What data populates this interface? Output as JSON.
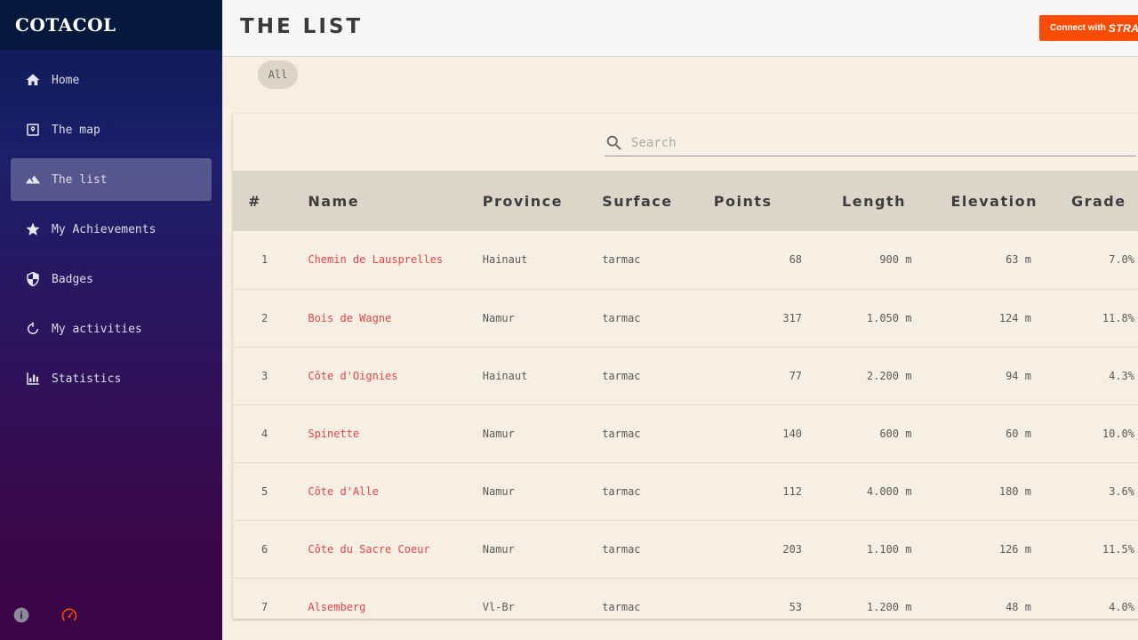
{
  "app": {
    "logo": "COTACOL"
  },
  "sidebar": {
    "items": [
      {
        "label": "Home",
        "icon": "home-icon"
      },
      {
        "label": "The map",
        "icon": "map-icon"
      },
      {
        "label": "The list",
        "icon": "mountain-icon",
        "active": true
      },
      {
        "label": "My Achievements",
        "icon": "star-icon"
      },
      {
        "label": "Badges",
        "icon": "shield-icon"
      },
      {
        "label": "My activities",
        "icon": "timer-icon"
      },
      {
        "label": "Statistics",
        "icon": "bar-chart-icon"
      }
    ],
    "bottom_icons": [
      "info-icon",
      "gauge-icon"
    ]
  },
  "header": {
    "title": "THE LIST",
    "strava_prefix": "Connect with",
    "strava_brand": "STRAVA"
  },
  "filters": {
    "chip": "All"
  },
  "search": {
    "placeholder": "Search"
  },
  "table": {
    "columns": [
      "#",
      "Name",
      "Province",
      "Surface",
      "Points",
      "Length",
      "Elevation",
      "Grade"
    ],
    "rows": [
      {
        "n": "1",
        "name": "Chemin de Lausprelles",
        "province": "Hainaut",
        "surface": "tarmac",
        "points": "68",
        "length": "900 m",
        "elevation": "63 m",
        "grade": "7.0%"
      },
      {
        "n": "2",
        "name": "Bois de Wagne",
        "province": "Namur",
        "surface": "tarmac",
        "points": "317",
        "length": "1.050 m",
        "elevation": "124 m",
        "grade": "11.8%"
      },
      {
        "n": "3",
        "name": "Côte d'Oignies",
        "province": "Hainaut",
        "surface": "tarmac",
        "points": "77",
        "length": "2.200 m",
        "elevation": "94 m",
        "grade": "4.3%"
      },
      {
        "n": "4",
        "name": "Spinette",
        "province": "Namur",
        "surface": "tarmac",
        "points": "140",
        "length": "600 m",
        "elevation": "60 m",
        "grade": "10.0%"
      },
      {
        "n": "5",
        "name": "Côte d'Alle",
        "province": "Namur",
        "surface": "tarmac",
        "points": "112",
        "length": "4.000 m",
        "elevation": "180 m",
        "grade": "3.6%"
      },
      {
        "n": "6",
        "name": "Côte du Sacre Coeur",
        "province": "Namur",
        "surface": "tarmac",
        "points": "203",
        "length": "1.100 m",
        "elevation": "126 m",
        "grade": "11.5%"
      },
      {
        "n": "7",
        "name": "Alsemberg",
        "province": "Vl-Br",
        "surface": "tarmac",
        "points": "53",
        "length": "1.200 m",
        "elevation": "48 m",
        "grade": "4.0%"
      }
    ]
  },
  "colors": {
    "accent": "#e0454a",
    "strava": "#fc4c02",
    "background": "#f8efe4"
  }
}
